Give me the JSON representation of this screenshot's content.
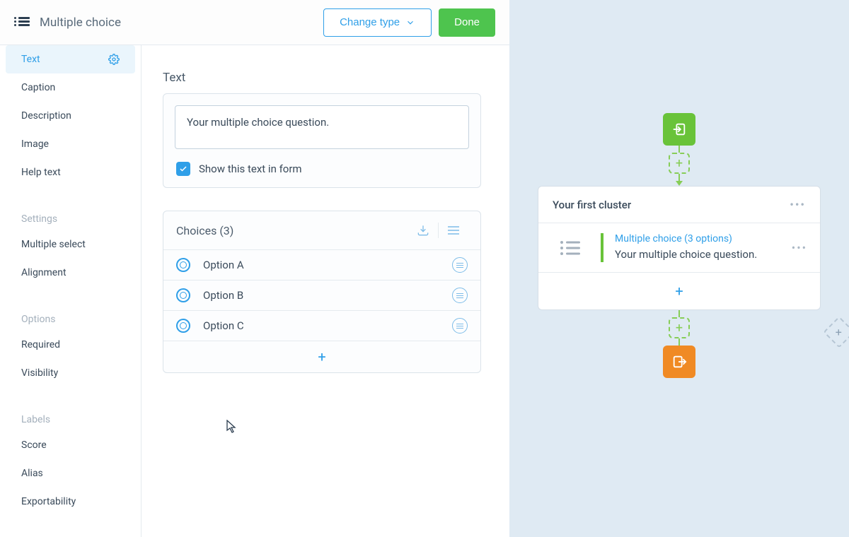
{
  "header": {
    "title": "Multiple choice",
    "change_type": "Change type",
    "done": "Done"
  },
  "sidebar": {
    "active_label": "Text",
    "content_items": [
      "Caption",
      "Description",
      "Image",
      "Help text"
    ],
    "settings_header": "Settings",
    "settings_items": [
      "Multiple select",
      "Alignment"
    ],
    "options_header": "Options",
    "options_items": [
      "Required",
      "Visibility"
    ],
    "labels_header": "Labels",
    "labels_items": [
      "Score",
      "Alias",
      "Exportability"
    ]
  },
  "main": {
    "text_label": "Text",
    "question_value": "Your multiple choice question.",
    "show_in_form": "Show this text in form",
    "show_in_form_checked": true,
    "choices_label": "Choices (3)",
    "choices": [
      "Option A",
      "Option B",
      "Option C"
    ]
  },
  "canvas": {
    "cluster_title": "Your first cluster",
    "block_type": "Multiple choice (3 options)",
    "block_text": "Your multiple choice question."
  }
}
